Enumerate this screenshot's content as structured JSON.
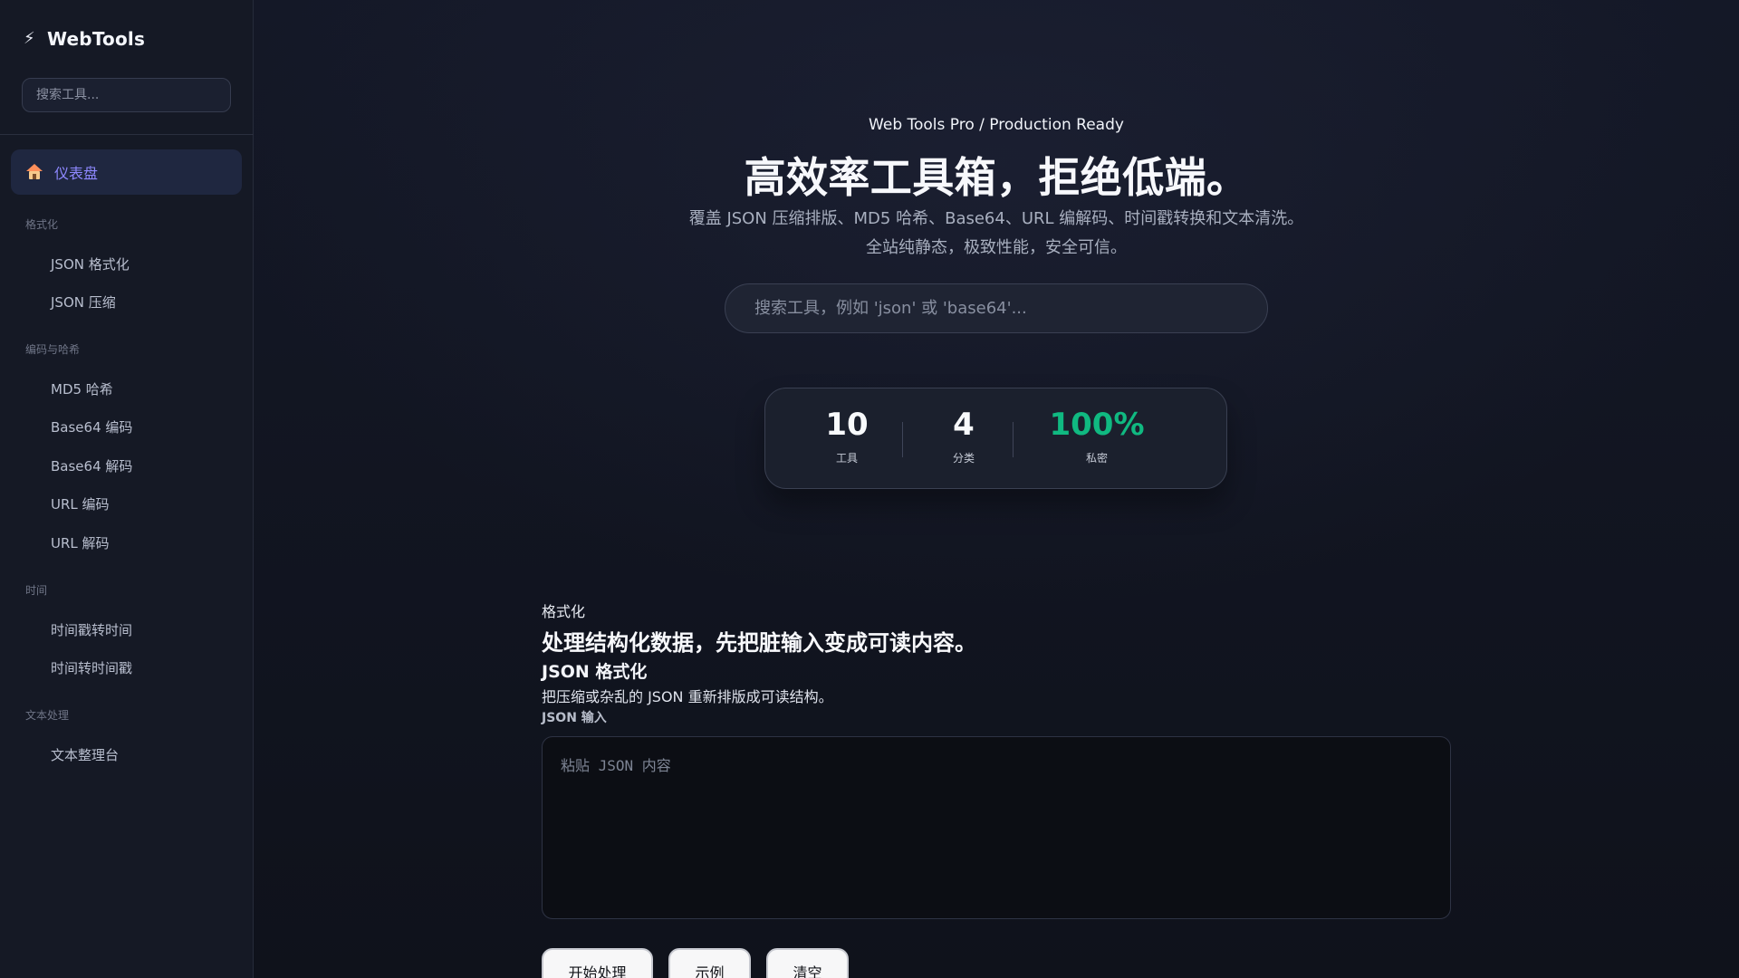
{
  "app": {
    "name": "WebTools"
  },
  "sidebar": {
    "search_placeholder": "搜索工具...",
    "active_item": "仪表盘",
    "groups": [
      {
        "label": "格式化",
        "items": [
          "JSON 格式化",
          "JSON 压缩"
        ]
      },
      {
        "label": "编码与哈希",
        "items": [
          "MD5 哈希",
          "Base64 编码",
          "Base64 解码",
          "URL 编码",
          "URL 解码"
        ]
      },
      {
        "label": "时间",
        "items": [
          "时间戳转时间",
          "时间转时间戳"
        ]
      },
      {
        "label": "文本处理",
        "items": [
          "文本整理台"
        ]
      }
    ]
  },
  "hero": {
    "kicker": "Web Tools Pro / Production Ready",
    "title": "高效率工具箱，拒绝低端。",
    "subtitle_line1": "覆盖 JSON 压缩排版、MD5 哈希、Base64、URL 编解码、时间戳转换和文本清洗。",
    "subtitle_line2": "全站纯静态，极致性能，安全可信。",
    "search_placeholder": "搜索工具，例如 'json' 或 'base64'..."
  },
  "stats": [
    {
      "value": "10",
      "label": "工具",
      "color": "#f8fafc"
    },
    {
      "value": "4",
      "label": "分类",
      "color": "#f8fafc"
    },
    {
      "value": "100%",
      "label": "私密",
      "color": "#10b981"
    }
  ],
  "section": {
    "tag": "格式化",
    "title": "处理结构化数据，先把脏输入变成可读内容。",
    "tool_title": "JSON 格式化",
    "tool_desc": "把压缩或杂乱的 JSON 重新排版成可读结构。",
    "input_label": "JSON 输入",
    "input_placeholder": "粘贴 JSON 内容",
    "buttons": [
      "开始处理",
      "示例",
      "清空"
    ]
  },
  "colors": {
    "accent": "#8e88ff",
    "success": "#10b981"
  }
}
